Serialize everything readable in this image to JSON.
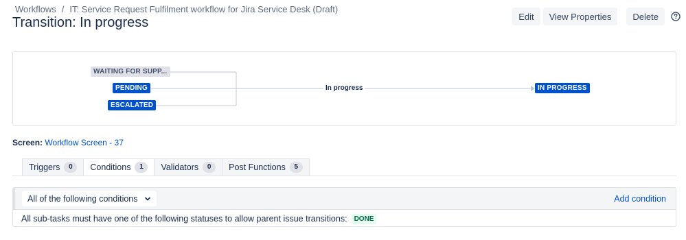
{
  "breadcrumb": {
    "items": [
      "Workflows",
      "IT: Service Request Fulfilment workflow for Jira Service Desk (Draft)"
    ],
    "separator": "/"
  },
  "page_title": "Transition: In progress",
  "actions": {
    "edit": "Edit",
    "view_properties": "View Properties",
    "delete": "Delete",
    "help_icon": "question-circle-icon"
  },
  "diagram": {
    "from_statuses": [
      "WAITING FOR SUPP...",
      "PENDING",
      "ESCALATED"
    ],
    "transition_label": "In progress",
    "to_status": "IN PROGRESS"
  },
  "screen": {
    "label": "Screen:",
    "link": "Workflow Screen - 37"
  },
  "tabs": [
    {
      "label": "Triggers",
      "count": "0"
    },
    {
      "label": "Conditions",
      "count": "1"
    },
    {
      "label": "Validators",
      "count": "0"
    },
    {
      "label": "Post Functions",
      "count": "5"
    }
  ],
  "active_tab": "Conditions",
  "conditions": {
    "group_select": "All of the following conditions",
    "add_link": "Add condition",
    "rule_text": "All sub-tasks must have one of the following statuses to allow parent issue transitions:",
    "rule_status": "DONE"
  },
  "colors": {
    "accent": "#0052cc",
    "text": "#172b4d",
    "done_text": "#006644",
    "done_bg": "#e3fcef"
  }
}
